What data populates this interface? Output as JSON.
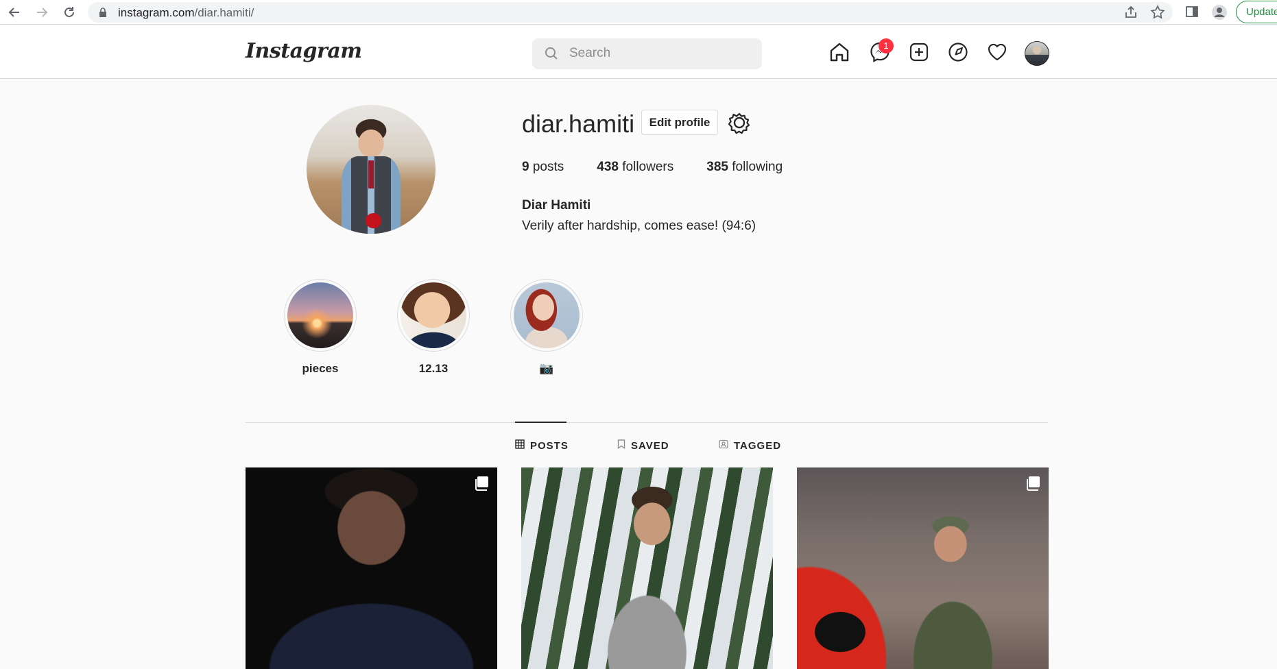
{
  "browser": {
    "url_domain": "instagram.com",
    "url_path": "/diar.hamiti/",
    "update_label": "Update"
  },
  "header": {
    "logo": "Instagram",
    "search_placeholder": "Search",
    "messenger_badge": "1"
  },
  "profile": {
    "username": "diar.hamiti",
    "edit_label": "Edit profile",
    "posts_count": "9",
    "posts_label": "posts",
    "followers_count": "438",
    "followers_label": "followers",
    "following_count": "385",
    "following_label": "following",
    "full_name": "Diar Hamiti",
    "bio": "Verily after hardship, comes ease! (94:6)"
  },
  "highlights": [
    {
      "label": "pieces"
    },
    {
      "label": "12.13"
    },
    {
      "label": "📷"
    }
  ],
  "tabs": [
    {
      "label": "POSTS",
      "active": true
    },
    {
      "label": "SAVED",
      "active": false
    },
    {
      "label": "TAGGED",
      "active": false
    }
  ],
  "colors": {
    "badge": "#ff3040",
    "update_green": "#1e8e3e",
    "text": "#262626",
    "muted": "#8e8e8e"
  }
}
